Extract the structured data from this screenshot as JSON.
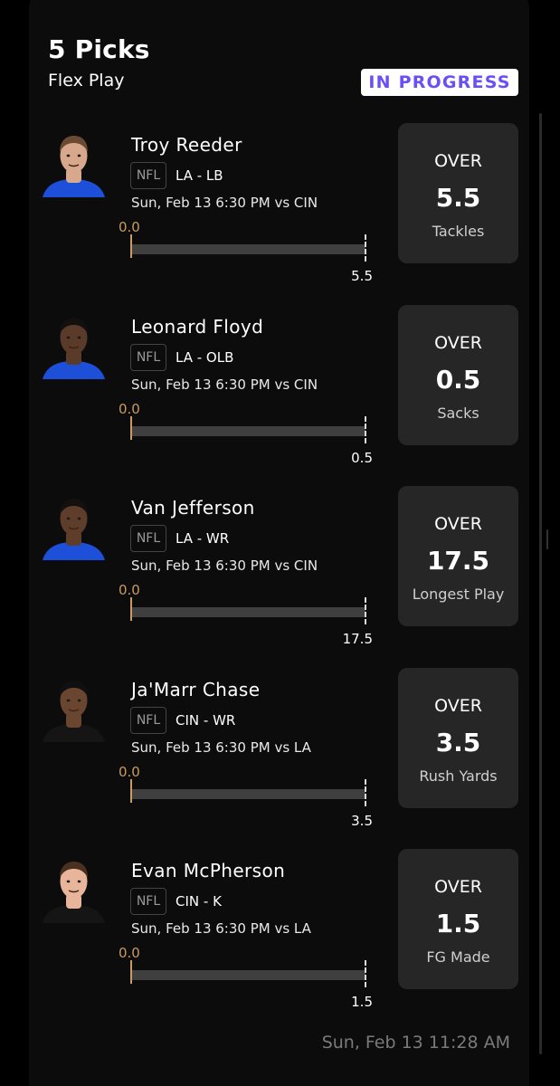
{
  "header": {
    "title": "5 Picks",
    "subtitle": "Flex Play",
    "status": "IN PROGRESS"
  },
  "colors": {
    "status_text": "#6a4ff5",
    "progress_accent": "#c99a62",
    "line_card_bg": "#262626"
  },
  "picks": [
    {
      "name": "Troy Reeder",
      "league": "NFL",
      "team_pos": "LA - LB",
      "game": "Sun, Feb 13 6:30 PM vs CIN",
      "current": "0.0",
      "target": "5.5",
      "progress": 0,
      "direction": "OVER",
      "line": "5.5",
      "stat": "Tackles",
      "avatar": {
        "skin": "#d8a88c",
        "hair": "#6b4a33",
        "jersey": "#1d4fd8"
      }
    },
    {
      "name": "Leonard Floyd",
      "league": "NFL",
      "team_pos": "LA - OLB",
      "game": "Sun, Feb 13 6:30 PM vs CIN",
      "current": "0.0",
      "target": "0.5",
      "progress": 0,
      "direction": "OVER",
      "line": "0.5",
      "stat": "Sacks",
      "avatar": {
        "skin": "#5a3a28",
        "hair": "#151010",
        "jersey": "#1d4fd8"
      }
    },
    {
      "name": "Van Jefferson",
      "league": "NFL",
      "team_pos": "LA - WR",
      "game": "Sun, Feb 13 6:30 PM vs CIN",
      "current": "0.0",
      "target": "17.5",
      "progress": 0,
      "direction": "OVER",
      "line": "17.5",
      "stat": "Longest Play",
      "avatar": {
        "skin": "#5e3d2a",
        "hair": "#151010",
        "jersey": "#1d4fd8"
      }
    },
    {
      "name": "Ja'Marr Chase",
      "league": "NFL",
      "team_pos": "CIN - WR",
      "game": "Sun, Feb 13 6:30 PM vs LA",
      "current": "0.0",
      "target": "3.5",
      "progress": 0,
      "direction": "OVER",
      "line": "3.5",
      "stat": "Rush Yards",
      "avatar": {
        "skin": "#6a4530",
        "hair": "#101010",
        "jersey": "#151515"
      }
    },
    {
      "name": "Evan McPherson",
      "league": "NFL",
      "team_pos": "CIN - K",
      "game": "Sun, Feb 13 6:30 PM vs LA",
      "current": "0.0",
      "target": "1.5",
      "progress": 0,
      "direction": "OVER",
      "line": "1.5",
      "stat": "FG Made",
      "avatar": {
        "skin": "#e8b59a",
        "hair": "#4a3020",
        "jersey": "#151515"
      }
    }
  ],
  "footer": {
    "timestamp": "Sun, Feb 13 11:28 AM"
  }
}
